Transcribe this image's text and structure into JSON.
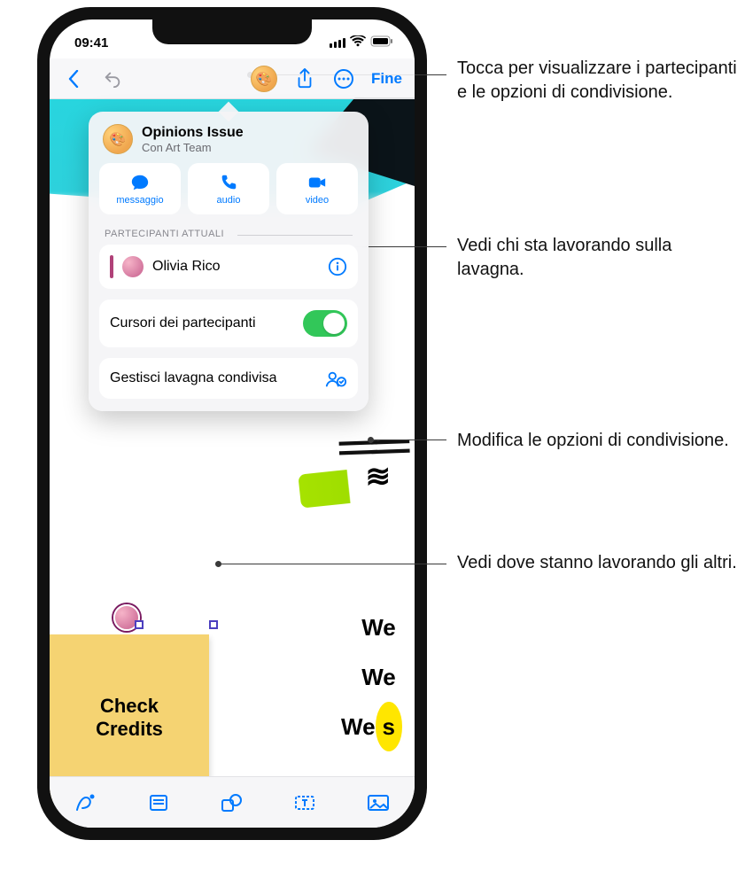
{
  "status": {
    "time": "09:41"
  },
  "nav": {
    "done": "Fine"
  },
  "popover": {
    "title": "Opinions Issue",
    "subtitle": "Con Art Team",
    "actions": {
      "message": "messaggio",
      "audio": "audio",
      "video": "video"
    },
    "section_label": "PARTECIPANTI ATTUALI",
    "participant": "Olivia Rico",
    "cursors_label": "Cursori dei partecipanti",
    "cursors_on": true,
    "manage_label": "Gestisci lavagna condivisa"
  },
  "canvas": {
    "sticky": "Check Credits",
    "we1": "We",
    "we2": "We",
    "we3a": "We",
    "we3b": "s"
  },
  "callouts": {
    "c1": "Tocca per visualizzare i partecipanti e le opzioni di condivisione.",
    "c2": "Vedi chi sta lavorando sulla lavagna.",
    "c3": "Modifica le opzioni di condivisione.",
    "c4": "Vedi dove stanno lavorando gli altri."
  }
}
